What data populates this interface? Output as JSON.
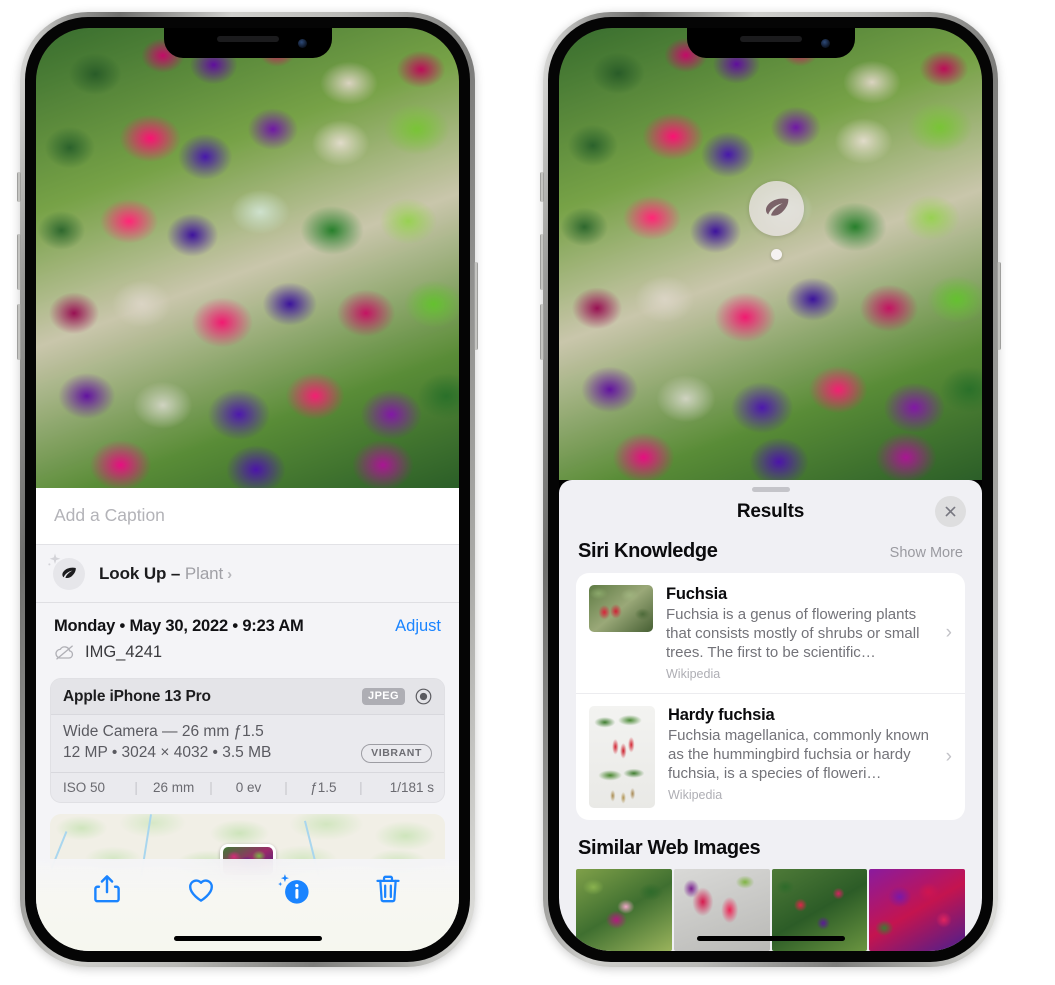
{
  "left_phone": {
    "caption": {
      "placeholder": "Add a Caption",
      "value": ""
    },
    "lookup": {
      "icon": "leaf-icon",
      "sparkle_icon": "sparkle-icon",
      "label": "Look Up –",
      "subject": "Plant",
      "chevron": "›"
    },
    "meta": {
      "date": "Monday • May 30, 2022 • 9:23 AM",
      "adjust_label": "Adjust",
      "cloud_icon": "cloud-slash-icon",
      "filename": "IMG_4241"
    },
    "camera": {
      "model": "Apple iPhone 13 Pro",
      "format_tag": "JPEG",
      "aperture_icon": "aperture-icon",
      "lens": "Wide Camera — 26 mm ƒ1.5",
      "specs": "12 MP • 3024 × 4032 • 3.5 MB",
      "style_tag": "VIBRANT",
      "exif": [
        "ISO 50",
        "26 mm",
        "0 ev",
        "ƒ1.5",
        "1/181 s"
      ]
    },
    "map": {
      "pin_label": "photo-thumbnail-pin"
    },
    "toolbar": [
      {
        "name": "share-button",
        "icon": "share-icon"
      },
      {
        "name": "favorite-button",
        "icon": "heart-icon"
      },
      {
        "name": "info-button",
        "icon": "info-sparkle-icon"
      },
      {
        "name": "delete-button",
        "icon": "trash-icon"
      }
    ]
  },
  "right_phone": {
    "visual_lookup": {
      "icon": "leaf-icon"
    },
    "sheet": {
      "grabber": "drag-handle",
      "title": "Results",
      "close_icon": "close-icon"
    },
    "siri_knowledge": {
      "title": "Siri Knowledge",
      "action": "Show More",
      "items": [
        {
          "title": "Fuchsia",
          "description": "Fuchsia is a genus of flowering plants that consists mostly of shrubs or small trees. The first to be scientific…",
          "source": "Wikipedia",
          "thumb": "fuchsia-red-flowers-thumbnail",
          "chevron": "›"
        },
        {
          "title": "Hardy fuchsia",
          "description": "Fuchsia magellanica, commonly known as the hummingbird fuchsia or hardy fuchsia, is a species of floweri…",
          "source": "Wikipedia",
          "thumb": "hardy-fuchsia-specimen-thumbnail",
          "chevron": "›"
        }
      ]
    },
    "similar_web_images": {
      "title": "Similar Web Images",
      "items": [
        {
          "name": "web-image-1"
        },
        {
          "name": "web-image-2"
        },
        {
          "name": "web-image-3"
        },
        {
          "name": "web-image-4"
        }
      ]
    }
  },
  "colors": {
    "accent_blue": "#1a84ff",
    "sheet_bg": "#f0f0f4",
    "card_bg": "#ffffff",
    "secondary_text": "#737379"
  }
}
